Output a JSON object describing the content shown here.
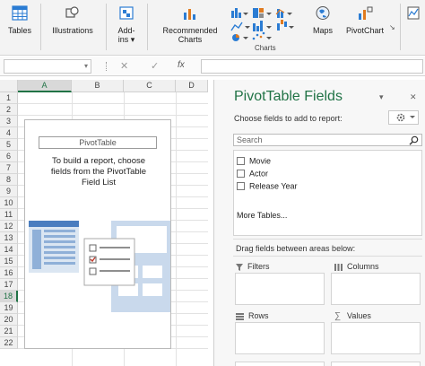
{
  "ribbon": {
    "tables_label": "Tables",
    "illustrations_label": "Illustrations",
    "addins_label_1": "Add-",
    "addins_label_2": "ins ▾",
    "recommended_charts_label_1": "Recommended",
    "recommended_charts_label_2": "Charts",
    "maps_label": "Maps",
    "pivotchart_label": "PivotChart",
    "charts_group_label": "Charts",
    "accent_color": "#217346",
    "chart_icon_colors": [
      "#2b7cd3",
      "#e07b20",
      "#8e8e8e"
    ]
  },
  "formula_bar": {
    "namebox_value": "",
    "cancel_symbol": "✕",
    "enter_symbol": "✓",
    "fx_label": "fx",
    "formula_value": ""
  },
  "sheet": {
    "columns": [
      "A",
      "B",
      "C",
      "D"
    ],
    "selected_column": "A",
    "rows": [
      "1",
      "2",
      "3",
      "4",
      "5",
      "6",
      "7",
      "8",
      "9",
      "10",
      "11",
      "12",
      "13",
      "14",
      "15",
      "16",
      "17",
      "18",
      "19",
      "20",
      "21",
      "22"
    ],
    "selected_row": "18"
  },
  "pivot_placeholder": {
    "title": "PivotTable",
    "line1": "To build a report, choose",
    "line2": "fields from the PivotTable",
    "line3": "Field List"
  },
  "pane": {
    "title": "PivotTable Fields",
    "dropdown_icon": "▾",
    "close_icon": "✕",
    "choose_label": "Choose fields to add to report:",
    "gear_icon": "gear-icon",
    "search_placeholder": "Search",
    "fields": [
      {
        "label": "Movie",
        "checked": false
      },
      {
        "label": "Actor",
        "checked": false
      },
      {
        "label": "Release Year",
        "checked": false
      }
    ],
    "more_tables": "More Tables...",
    "drag_label": "Drag fields between areas below:",
    "areas": {
      "filters": "Filters",
      "columns": "Columns",
      "rows": "Rows",
      "values": "Values"
    }
  }
}
